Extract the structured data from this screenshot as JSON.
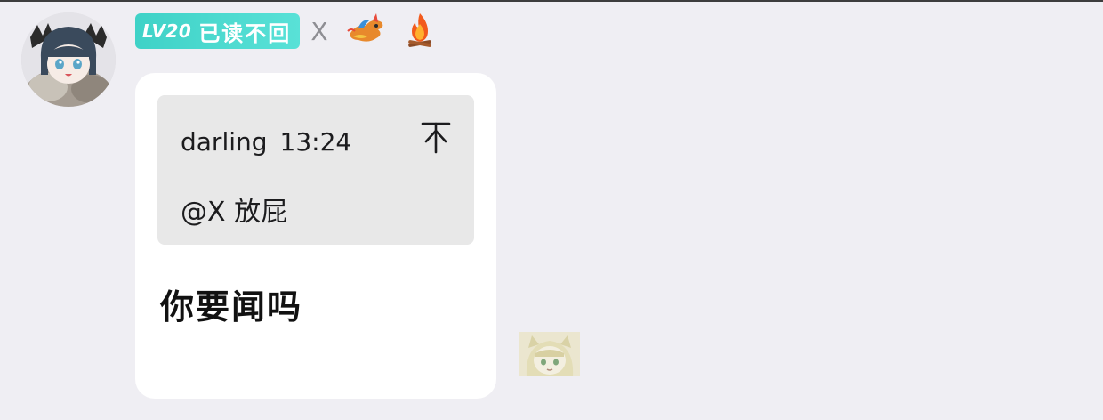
{
  "sender": {
    "level_badge": "LV20",
    "badge_text": "已读不回",
    "name": "X",
    "title_icons": [
      "dragon-icon",
      "fire-icon"
    ]
  },
  "message": {
    "quote": {
      "author": "darling",
      "time": "13:24",
      "text": "@X 放屁"
    },
    "text": "你要闻吗"
  },
  "colors": {
    "background": "#efeef3",
    "badge": "#4fd8ce",
    "bubble": "#ffffff",
    "quote_bg": "#e8e8e8"
  }
}
